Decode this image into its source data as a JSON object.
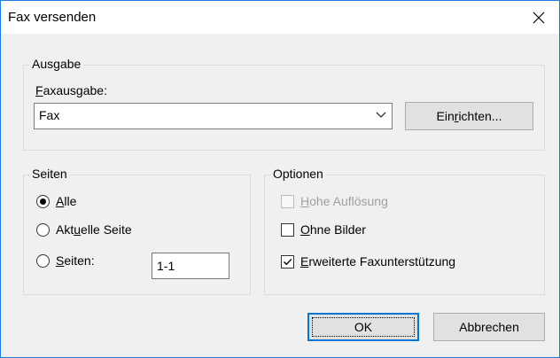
{
  "window": {
    "title": "Fax versenden"
  },
  "ausgabe": {
    "legend": "Ausgabe",
    "faxausgabe_label_accel": "F",
    "faxausgabe_label_rest": "axausgabe:",
    "combo_value": "Fax",
    "setup_button_pre": "Ein",
    "setup_button_accel": "r",
    "setup_button_post": "ichten..."
  },
  "seiten": {
    "legend": "Seiten",
    "options": [
      {
        "pre": "",
        "accel": "A",
        "post": "lle",
        "checked": true
      },
      {
        "pre": "Akt",
        "accel": "u",
        "post": "elle Seite",
        "checked": false
      },
      {
        "pre": "",
        "accel": "S",
        "post": "eiten:",
        "checked": false
      }
    ],
    "range_value": "1-1"
  },
  "optionen": {
    "legend": "Optionen",
    "checks": [
      {
        "accel": "H",
        "post": "ohe Auflösung",
        "checked": false,
        "disabled": true
      },
      {
        "accel": "O",
        "post": "hne Bilder",
        "checked": false,
        "disabled": false
      },
      {
        "accel": "E",
        "post": "rweiterte Faxunterstützung",
        "checked": true,
        "disabled": false
      }
    ]
  },
  "buttons": {
    "ok": "OK",
    "cancel": "Abbrechen"
  },
  "colors": {
    "accent": "#0078d7",
    "desktop": "#1e90ff"
  },
  "icons": {
    "close": "close-icon",
    "dropdown": "chevron-down-icon",
    "check": "checkmark-icon"
  }
}
